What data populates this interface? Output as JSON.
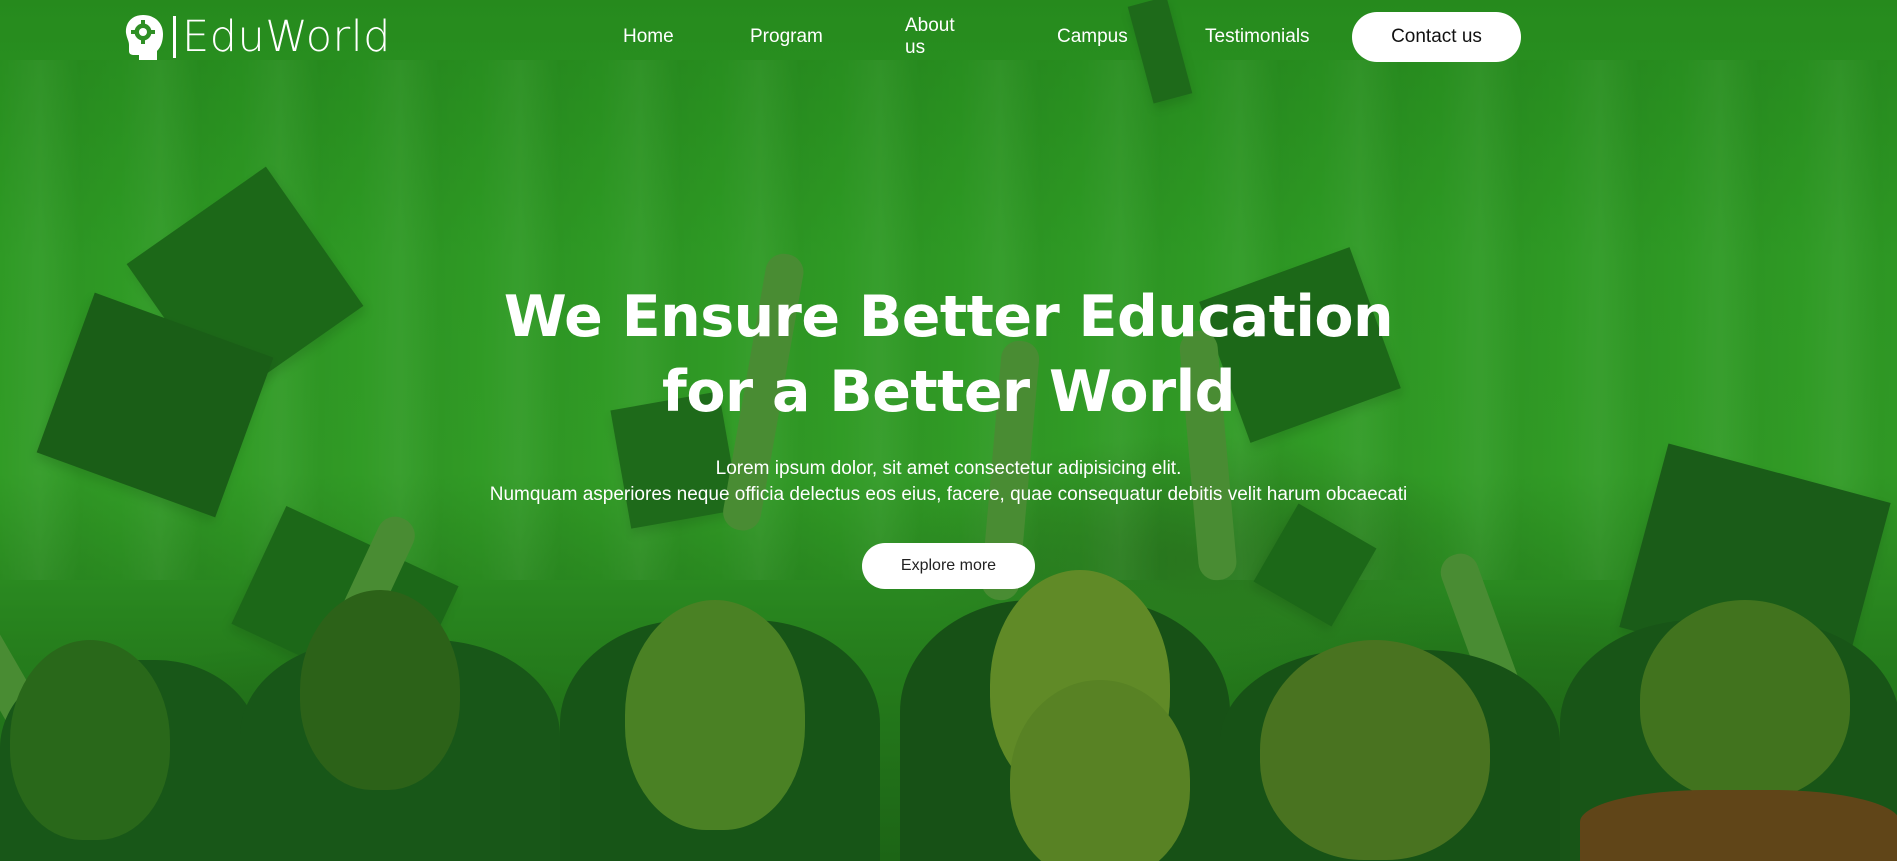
{
  "brand": {
    "name": "EduWorld",
    "logo_icon": "head-gear-icon"
  },
  "nav": {
    "items": [
      {
        "label": "Home"
      },
      {
        "label": "Program"
      },
      {
        "label": "About us"
      },
      {
        "label": "Campus"
      },
      {
        "label": "Testimonials"
      }
    ],
    "contact_label": "Contact us"
  },
  "hero": {
    "title_line1": "We Ensure Better Education",
    "title_line2": "for a Better World",
    "subtitle_line1": "Lorem ipsum dolor, sit amet consectetur adipisicing elit.",
    "subtitle_line2": "Numquam asperiores neque officia delectus eos eius, facere, quae consequatur debitis velit harum obcaecati",
    "cta_label": "Explore more"
  },
  "colors": {
    "overlay_green": "#2f9a23",
    "text": "#ffffff",
    "button_bg": "#ffffff"
  }
}
